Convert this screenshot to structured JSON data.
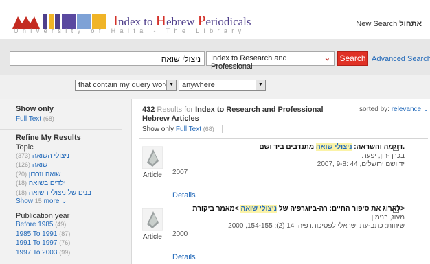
{
  "header": {
    "logo_title": {
      "p1": "I",
      "p2": "ndex to ",
      "p3": "H",
      "p4": "ebrew ",
      "p5": "P",
      "p6": "eriodicals"
    },
    "logo_subtitle": "University of Haifa - The Library",
    "new_search_en": "New Search",
    "new_search_he": "אתחול"
  },
  "search": {
    "query": "ניצולי שואה",
    "collection": "Index to Research and Professional",
    "search_label": "Search",
    "advanced_label": "Advanced Search"
  },
  "filters": {
    "match": "that contain my query words",
    "where": "anywhere"
  },
  "sidebar": {
    "show_only_heading": "Show only",
    "full_text": {
      "label": "Full Text",
      "count": "(68)"
    },
    "refine_heading": "Refine My Results",
    "topic_heading": "Topic",
    "topics": [
      {
        "label": "ניצולי השואה",
        "count": "(373)"
      },
      {
        "label": "שואה",
        "count": "(126)"
      },
      {
        "label": "שואה וזכרון",
        "count": "(20)"
      },
      {
        "label": "ילדים בשואה",
        "count": "(18)"
      },
      {
        "label": "בנים של ניצולי השואה",
        "count": "(18)"
      }
    ],
    "show_more": {
      "show": "Show",
      "num": "15",
      "more": "more"
    },
    "year_heading": "Publication year",
    "years": [
      {
        "label": "Before 1985",
        "count": "(49)"
      },
      {
        "label": "1985 To 1991",
        "count": "(87)"
      },
      {
        "label": "1991 To 1997",
        "count": "(76)"
      },
      {
        "label": "1997 To 2003",
        "count": "(99)"
      }
    ]
  },
  "results": {
    "count": "432",
    "results_for": "Results for",
    "collection": "Index to Research and Professional Hebrew Articles",
    "sorted_by": "sorted by:",
    "sort_value": "relevance",
    "show_only": "Show only",
    "full_text": "Full Text",
    "full_text_count": "(68)",
    "items": [
      {
        "title_pre": ".דוגמה והשראה: ",
        "title_hl": "ניצולי שואה",
        "title_post": " מתנדבים ביד ושם",
        "author": "בכרך-רון, יפעת",
        "source": "יד ושם ירושלים, 44 :9-8 ,2007",
        "year": "2007",
        "format": "Article",
        "details": "Details"
      },
      {
        "title_pre": "<לארוג את סיפור החיים: רה-ביוגרפיה של ",
        "title_hl": "ניצולי שואה",
        "title_post": " >מאמר ביקורת",
        "author": "מעוז, בנימין",
        "source": "שיחות: כתב-עת ישראלי לפסיכותרפיה, 14 (2): 154-155, 2000",
        "year": "2000",
        "format": "Article",
        "details": "Details"
      }
    ]
  },
  "colors": {
    "accent_red": "#e03125",
    "link_blue": "#2269b9",
    "logo_purple": "#4f3f8b",
    "highlight": "#fbf3a7"
  }
}
